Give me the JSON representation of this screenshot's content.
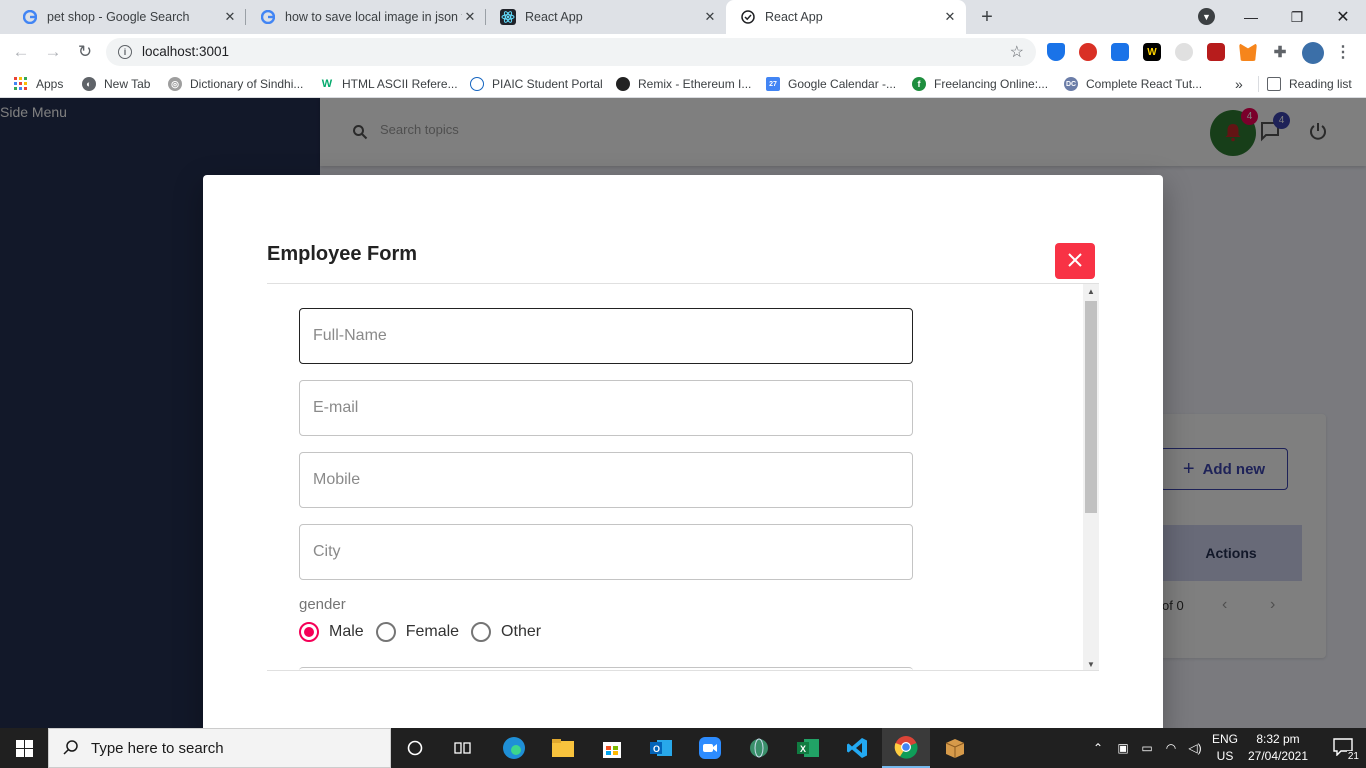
{
  "browser": {
    "tabs": [
      {
        "title": "pet shop - Google Search",
        "icon": "google-icon"
      },
      {
        "title": "how to save local image in json f",
        "icon": "google-icon"
      },
      {
        "title": "React App",
        "icon": "react-icon"
      },
      {
        "title": "React App",
        "icon": "page-icon",
        "active": true
      }
    ],
    "url": "localhost:3001",
    "bookmarks": [
      {
        "label": "Apps",
        "icon": "apps-grid-icon"
      },
      {
        "label": "New Tab",
        "icon": "globe-icon"
      },
      {
        "label": "Dictionary of Sindhi...",
        "icon": "dictionary-icon"
      },
      {
        "label": "HTML ASCII Refere...",
        "icon": "w3-icon"
      },
      {
        "label": "PIAIC Student Portal",
        "icon": "piaic-icon"
      },
      {
        "label": "Remix - Ethereum I...",
        "icon": "remix-icon"
      },
      {
        "label": "Google Calendar -...",
        "icon": "calendar-icon"
      },
      {
        "label": "Freelancing Online:...",
        "icon": "freelancing-icon"
      },
      {
        "label": "Complete React Tut...",
        "icon": "dc-icon"
      }
    ],
    "more_bookmarks": "»",
    "reading_list": "Reading list"
  },
  "app": {
    "side_menu_label": "Side Menu",
    "search_placeholder": "Search topics",
    "notifications_count": "4",
    "messages_count": "4",
    "add_new_label": "Add new",
    "actions_header": "Actions",
    "pagination_text": "of 0"
  },
  "dialog": {
    "title": "Employee Form",
    "fields": {
      "fullname_placeholder": "Full-Name",
      "email_placeholder": "E-mail",
      "mobile_placeholder": "Mobile",
      "city_placeholder": "City"
    },
    "gender_label": "gender",
    "gender_options": [
      "Male",
      "Female",
      "Other"
    ],
    "gender_selected": "Male"
  },
  "taskbar": {
    "search_text": "Type here to search",
    "lang_line1": "ENG",
    "lang_line2": "US",
    "time": "8:32 pm",
    "date": "27/04/2021",
    "notification_count": "21"
  },
  "colors": {
    "sidemenu": "#253053",
    "accent": "#3c44b1",
    "notif_badge": "#f50057",
    "close_button": "#f83245",
    "radio_checked": "#f50057"
  }
}
